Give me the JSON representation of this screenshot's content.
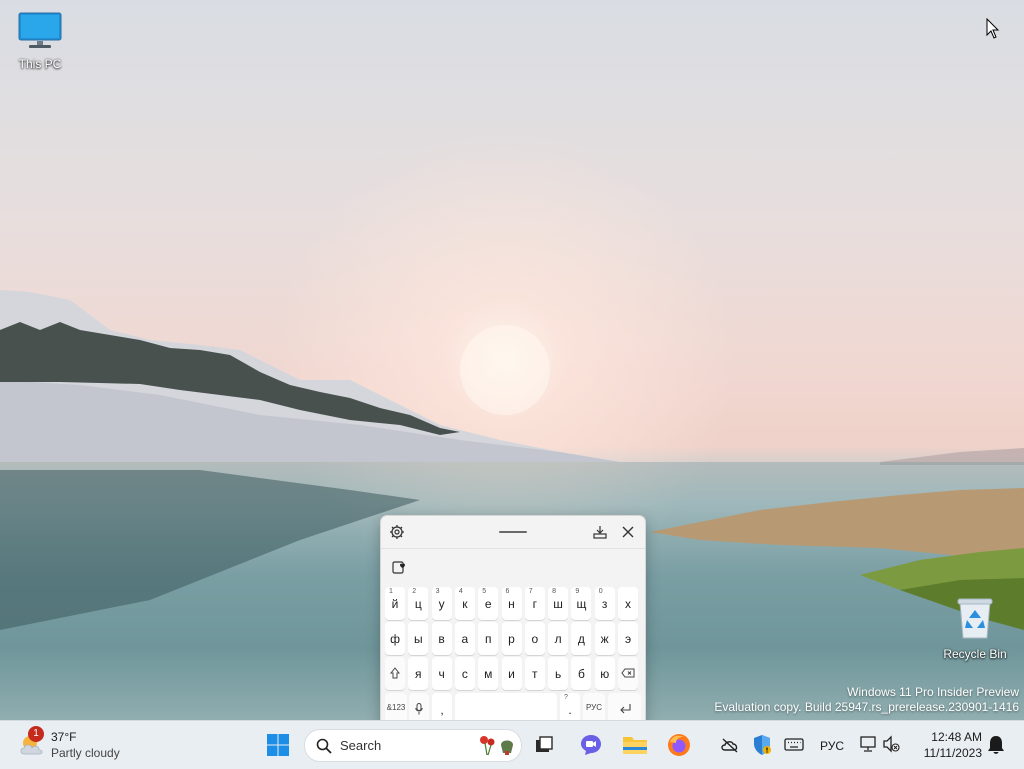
{
  "desktop": {
    "icons": [
      {
        "label": "This PC",
        "icon": "monitor-icon"
      },
      {
        "label": "Recycle Bin",
        "icon": "recycle-bin-icon"
      }
    ],
    "watermark_line1": "Windows 11 Pro Insider Preview",
    "watermark_line2": "Evaluation copy. Build 25947.rs_prerelease.230901-1416"
  },
  "keyboard": {
    "row1": [
      {
        "sup": "1",
        "ch": "й"
      },
      {
        "sup": "2",
        "ch": "ц"
      },
      {
        "sup": "3",
        "ch": "у"
      },
      {
        "sup": "4",
        "ch": "к"
      },
      {
        "sup": "5",
        "ch": "е"
      },
      {
        "sup": "6",
        "ch": "н"
      },
      {
        "sup": "7",
        "ch": "г"
      },
      {
        "sup": "8",
        "ch": "ш"
      },
      {
        "sup": "9",
        "ch": "щ"
      },
      {
        "sup": "0",
        "ch": "з"
      },
      {
        "sup": "",
        "ch": "х"
      }
    ],
    "row2": [
      "ф",
      "ы",
      "в",
      "а",
      "п",
      "р",
      "о",
      "л",
      "д",
      "ж",
      "э"
    ],
    "row3": [
      "я",
      "ч",
      "с",
      "м",
      "и",
      "т",
      "ь",
      "б",
      "ю"
    ],
    "symbols_label": "&123",
    "comma_label": ",",
    "period_label": ".",
    "period_sup": "?",
    "lang_label": "РУС"
  },
  "taskbar": {
    "weather": {
      "badge": "1",
      "temp": "37°F",
      "condition": "Partly cloudy"
    },
    "search_placeholder": "Search",
    "tray": {
      "language": "РУС"
    },
    "clock": {
      "time": "12:48 AM",
      "date": "11/11/2023"
    }
  },
  "colors": {
    "accent": "#0078d4",
    "taskbar_bg": "#e9eef3",
    "keyboard_bg": "#f3f3f3"
  }
}
